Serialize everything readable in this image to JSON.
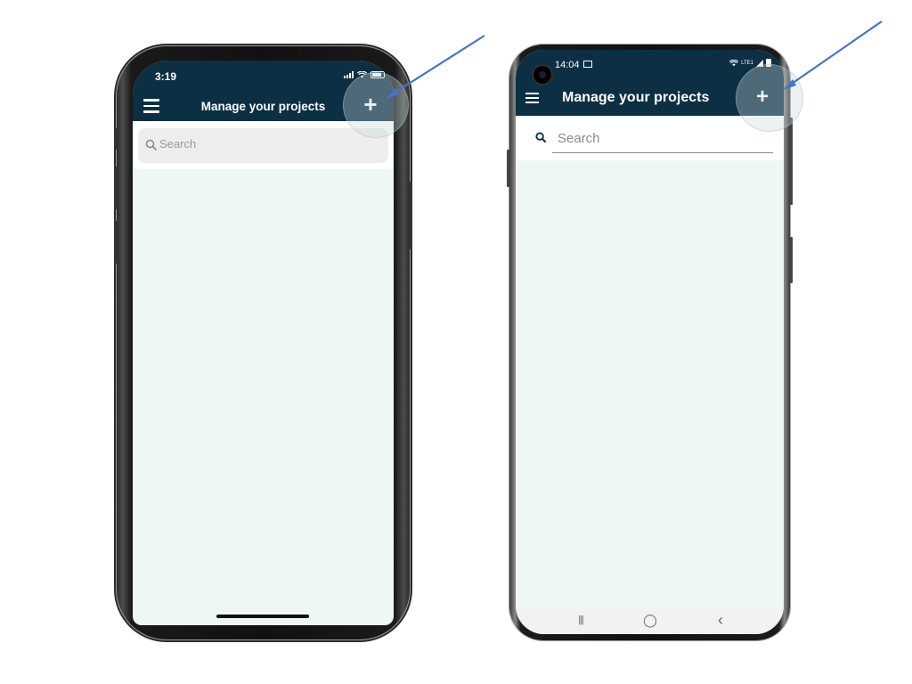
{
  "ios": {
    "status_time": "3:19",
    "title": "Manage your projects",
    "add_label": "+",
    "search_placeholder": "Search"
  },
  "android": {
    "status_time": "14:04",
    "status_network": "LTE1",
    "title": "Manage your projects",
    "add_label": "+",
    "search_placeholder": "Search",
    "nav": {
      "recents": "|||",
      "home": "◯",
      "back": "‹"
    }
  },
  "colors": {
    "header": "#0d2f44",
    "list_background": "#eff7f6",
    "annotation_arrow": "#4a72c4"
  },
  "icons": [
    "menu-icon",
    "add-icon",
    "search-icon",
    "signal-icon",
    "wifi-icon",
    "battery-icon",
    "camera-icon",
    "image-icon"
  ]
}
